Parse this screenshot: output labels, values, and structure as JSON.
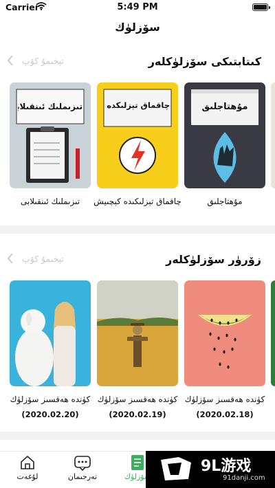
{
  "status": {
    "carrier": "Carrier",
    "time": "5:49 PM"
  },
  "nav": {
    "title": "سۆزلۈك"
  },
  "sections": [
    {
      "title": "كىتابتىكى سۆزلۈكلەر",
      "more": "تېخىمۇ كۆپ",
      "items": [
        {
          "label": "مۇھتاجلىق",
          "cover_title": "مۇھتاجلىق",
          "cover_color": "#3a3a42"
        },
        {
          "label": "چاقماق تېزلىكىدە كېچىيش",
          "cover_title": "چاقماق تېزلىكدە كېچىيش",
          "cover_color": "#f7cf1b"
        },
        {
          "label": "تىزىملىك ئىنقىلابى",
          "cover_title": "تىزىملىك ئىنقىلابى",
          "cover_color": "#c9d2d6"
        }
      ]
    },
    {
      "title": "زۆرۈر سۆزلۈكلەر",
      "more": "تېخىمۇ كۆپ",
      "items": [
        {
          "label": "كۈندە ھەقسىز سۆزلۈك",
          "date": "(2020.02.18)",
          "cover_color": "#ef8c7d"
        },
        {
          "label": "كۈندە ھەقسىز سۆزلۈك",
          "date": "(2020.02.19)",
          "cover_color": "#d6b25a"
        },
        {
          "label": "كۈندە ھەقسىز سۆزلۈك",
          "date": "(2020.02.20)",
          "cover_color": "#3ab3dc"
        }
      ]
    }
  ],
  "tabs": [
    {
      "label": "لۇغەت",
      "icon": "house-icon"
    },
    {
      "label": "تەرجىمان",
      "icon": "chat-bubble-icon"
    },
    {
      "label": "سۆزلۈك",
      "icon": "notebook-icon",
      "active": true
    }
  ],
  "watermark": {
    "logo": "9L游戏",
    "url": "91danji.com"
  },
  "colors": {
    "accent": "#3cae5e",
    "divider": "#f2f2f4"
  }
}
